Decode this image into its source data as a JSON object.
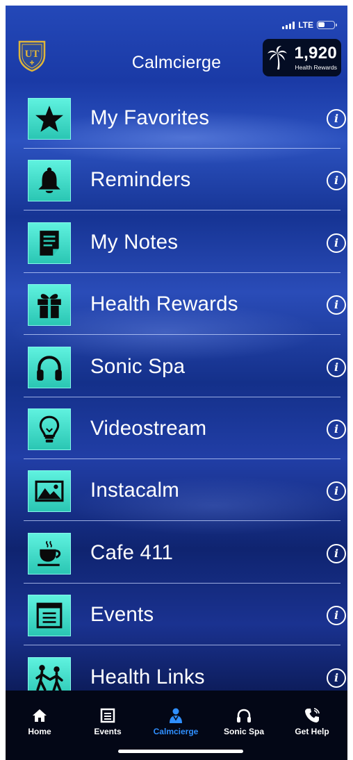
{
  "status": {
    "network": "LTE",
    "battery_level": 0.45
  },
  "header": {
    "logo_text": "UT",
    "title": "Calmcierge",
    "rewards_value": "1,920",
    "rewards_label": "Health Rewards"
  },
  "menu": [
    {
      "label": "My Favorites",
      "icon": "star-icon"
    },
    {
      "label": "Reminders",
      "icon": "bell-icon"
    },
    {
      "label": "My Notes",
      "icon": "note-icon"
    },
    {
      "label": "Health Rewards",
      "icon": "gift-icon"
    },
    {
      "label": "Sonic Spa",
      "icon": "headphones-icon"
    },
    {
      "label": "Videostream",
      "icon": "lightbulb-icon"
    },
    {
      "label": "Instacalm",
      "icon": "landscape-image-icon"
    },
    {
      "label": "Cafe 411",
      "icon": "coffee-cup-icon"
    },
    {
      "label": "Events",
      "icon": "document-list-icon"
    },
    {
      "label": "Health Links",
      "icon": "people-icon"
    }
  ],
  "info_glyph": "i",
  "tabs": [
    {
      "label": "Home",
      "icon": "home-icon"
    },
    {
      "label": "Events",
      "icon": "list-icon"
    },
    {
      "label": "Calmcierge",
      "icon": "concierge-icon",
      "active": true
    },
    {
      "label": "Sonic Spa",
      "icon": "headphones-icon"
    },
    {
      "label": "Get Help",
      "icon": "phone-icon"
    }
  ],
  "colors": {
    "accent_teal": "#2ac6b3",
    "active_tab": "#2f8fff",
    "tab_bar": "#030716",
    "background_blue": "#1a3aa6"
  }
}
